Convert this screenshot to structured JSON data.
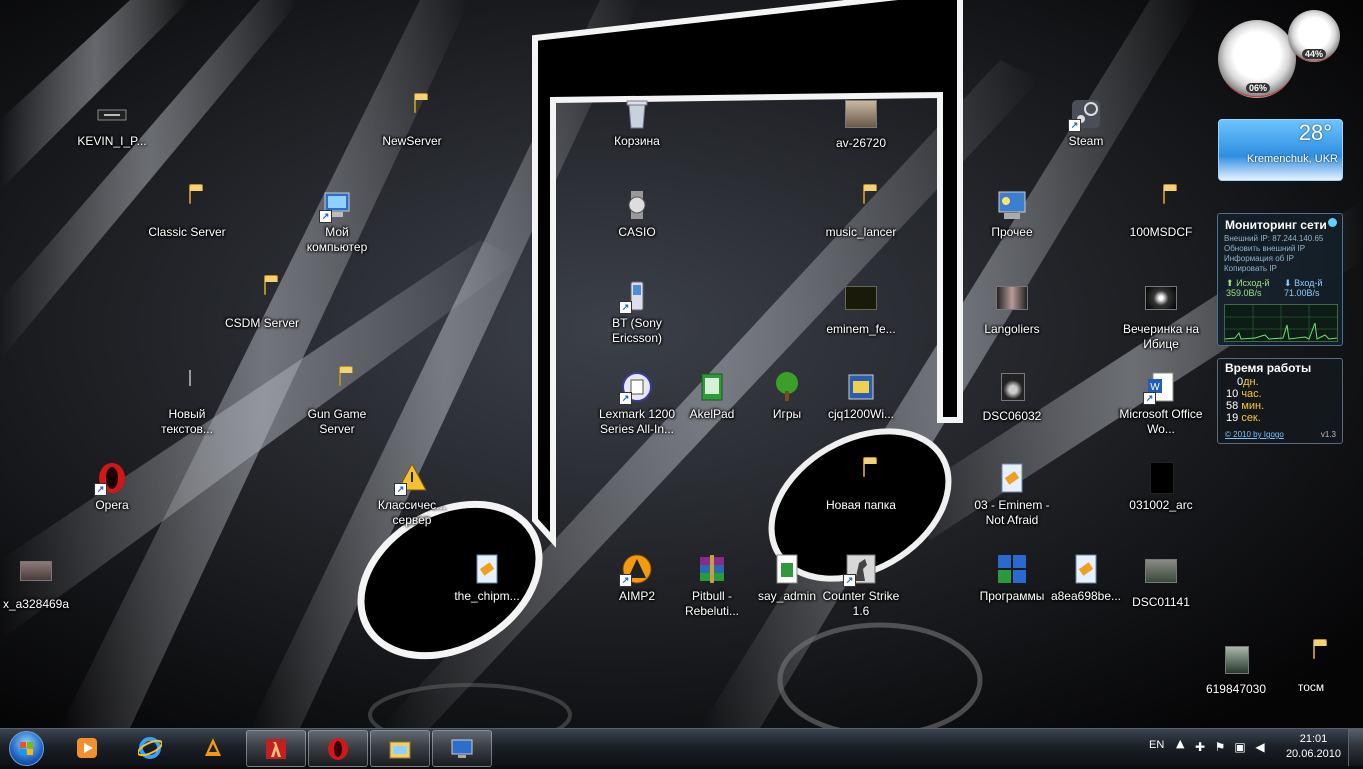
{
  "desktop": {
    "icons": [
      {
        "id": "kevin",
        "label": "KEVIN_I_P..."
      },
      {
        "id": "newserver",
        "label": "NewServer"
      },
      {
        "id": "recycle",
        "label": "Корзина"
      },
      {
        "id": "av",
        "label": "av-26720"
      },
      {
        "id": "steam",
        "label": "Steam"
      },
      {
        "id": "classic",
        "label": "Classic Server"
      },
      {
        "id": "mycomp",
        "label": "Мой компьютер"
      },
      {
        "id": "casio",
        "label": "CASIO"
      },
      {
        "id": "musiclancer",
        "label": "music_lancer"
      },
      {
        "id": "prochee",
        "label": "Прочее"
      },
      {
        "id": "100msdcf",
        "label": "100MSDCF"
      },
      {
        "id": "csdm",
        "label": "CSDM Server"
      },
      {
        "id": "bt",
        "label": "BT (Sony Ericsson)"
      },
      {
        "id": "eminemfe",
        "label": "eminem_fe..."
      },
      {
        "id": "langoliers",
        "label": "Langoliers"
      },
      {
        "id": "vecherinka",
        "label": "Вечеринка на Ибице"
      },
      {
        "id": "newtext",
        "label": "Новый текстов..."
      },
      {
        "id": "gungame",
        "label": "Gun Game Server"
      },
      {
        "id": "lexmark",
        "label": "Lexmark 1200 Series All-In..."
      },
      {
        "id": "akelpad",
        "label": "AkelPad"
      },
      {
        "id": "igry",
        "label": "Игры"
      },
      {
        "id": "cjq",
        "label": "cjq1200Wi..."
      },
      {
        "id": "dsc06032",
        "label": "DSC06032"
      },
      {
        "id": "msoffice",
        "label": "Microsoft Office Wo..."
      },
      {
        "id": "opera",
        "label": "Opera"
      },
      {
        "id": "klassich",
        "label": "Классичес... сервер"
      },
      {
        "id": "novpapka",
        "label": "Новая папка"
      },
      {
        "id": "eminemnaf",
        "label": "03 - Eminem - Not Afraid"
      },
      {
        "id": "031002",
        "label": "031002_arc"
      },
      {
        "id": "xa",
        "label": "x_a328469a"
      },
      {
        "id": "chipm",
        "label": "the_chipm..."
      },
      {
        "id": "aimp",
        "label": "AIMP2"
      },
      {
        "id": "pitbull",
        "label": "Pitbull - Rebeluti..."
      },
      {
        "id": "sayadmin",
        "label": "say_admin"
      },
      {
        "id": "cs16",
        "label": "Counter Strike 1.6"
      },
      {
        "id": "programmy",
        "label": "Программы"
      },
      {
        "id": "a8ea",
        "label": "a8ea698be..."
      },
      {
        "id": "dsc01141",
        "label": "DSC01141"
      },
      {
        "id": "619847030",
        "label": "619847030"
      },
      {
        "id": "tosm",
        "label": "тосм"
      }
    ]
  },
  "gadgets": {
    "cpu": {
      "value": "06%"
    },
    "memory": {
      "value": "44%"
    },
    "weather": {
      "temp": "28°",
      "city": "Kremenchuk, UKR"
    },
    "net_monitor": {
      "title": "Мониторинг сети",
      "external_ip": "Внешний IP: 87.244.140.65",
      "refresh": "Обновить внешний IP",
      "ip_info": "Информация об IP",
      "copy_ip": "Копировать IP",
      "out_label": "Исход-й",
      "out_value": "359.0B/s",
      "in_label": "Вход-й",
      "in_value": "71.00B/s"
    },
    "uptime": {
      "title": "Время работы",
      "days": "0",
      "days_unit": "дн.",
      "hours": "10",
      "hours_unit": "час.",
      "minutes": "58",
      "minutes_unit": "мин.",
      "seconds": "19",
      "seconds_unit": "сек.",
      "copyright": "© 2010 by Igogo",
      "version": "v1.3"
    }
  },
  "taskbar": {
    "pinned": [
      "media-player-icon",
      "internet-explorer-icon",
      "aimp-icon",
      "half-life-icon",
      "opera-icon",
      "explorer-icon",
      "remote-desktop-icon"
    ],
    "tray": {
      "language": "EN",
      "time": "21:01",
      "date": "20.06.2010"
    }
  }
}
